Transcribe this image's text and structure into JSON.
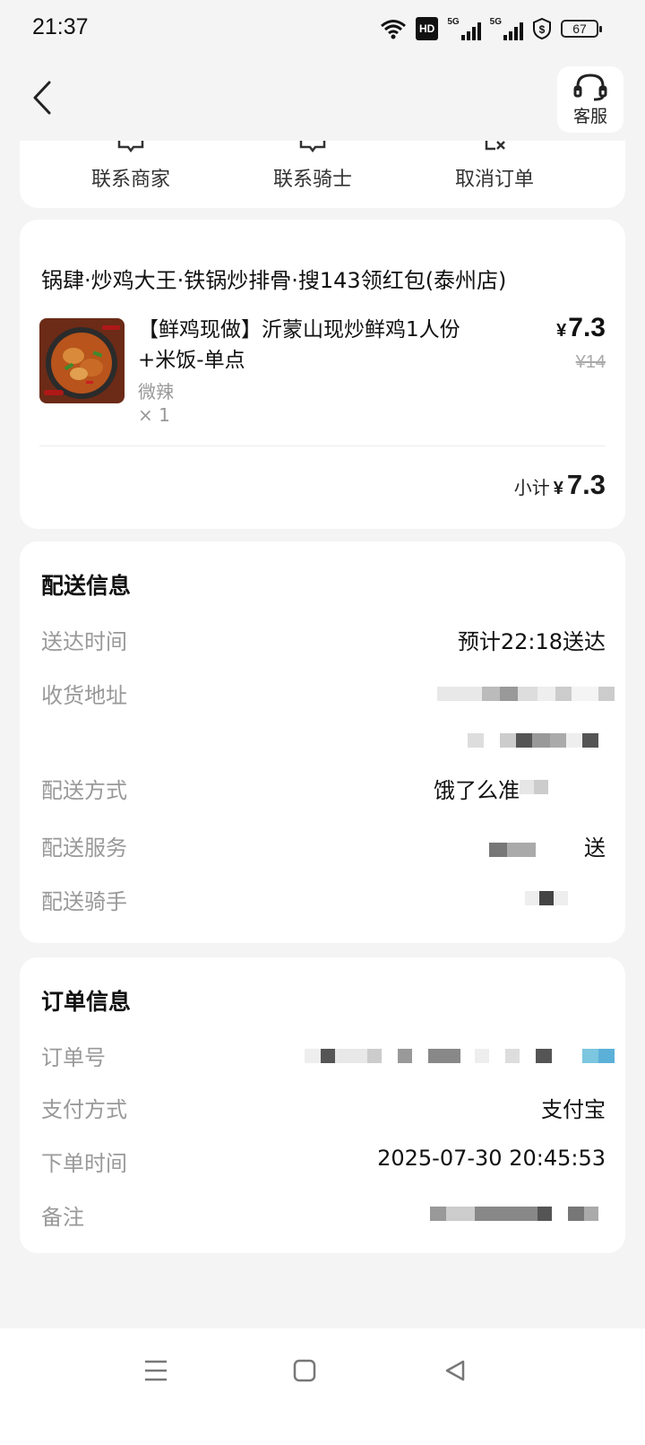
{
  "status_bar": {
    "time": "21:37",
    "hd_label": "HD",
    "net_label_1": "5G",
    "net_label_2": "5G",
    "battery": "67"
  },
  "header": {
    "service_label": "客服"
  },
  "actions": {
    "contact_merchant": "联系商家",
    "contact_rider": "联系骑士",
    "cancel_order": "取消订单"
  },
  "order": {
    "shop_name": "锅肆·炒鸡大王·铁锅炒排骨·搜143领红包(泰州店)",
    "item": {
      "name": "【鲜鸡现做】沂蒙山现炒鲜鸡1人份+米饭-单点",
      "spec": "微辣",
      "quantity": "× 1",
      "price_symbol": "¥",
      "price": "7.3",
      "original_price": "¥14"
    },
    "subtotal_label": "小计",
    "subtotal_symbol": "¥",
    "subtotal": "7.3"
  },
  "delivery": {
    "title": "配送信息",
    "time_label": "送达时间",
    "time_value": "预计22:18送达",
    "address_label": "收货地址",
    "method_label": "配送方式",
    "method_value": "饿了么准",
    "service_label": "配送服务",
    "service_value": "送",
    "rider_label": "配送骑手"
  },
  "info": {
    "title": "订单信息",
    "order_no_label": "订单号",
    "payment_label": "支付方式",
    "payment_value": "支付宝",
    "order_time_label": "下单时间",
    "order_time_value": "2025-07-30 20:45:53",
    "remark_label": "备注"
  },
  "colors": {
    "background": "#f4f4f5",
    "card": "#ffffff",
    "muted_text": "#999999"
  }
}
